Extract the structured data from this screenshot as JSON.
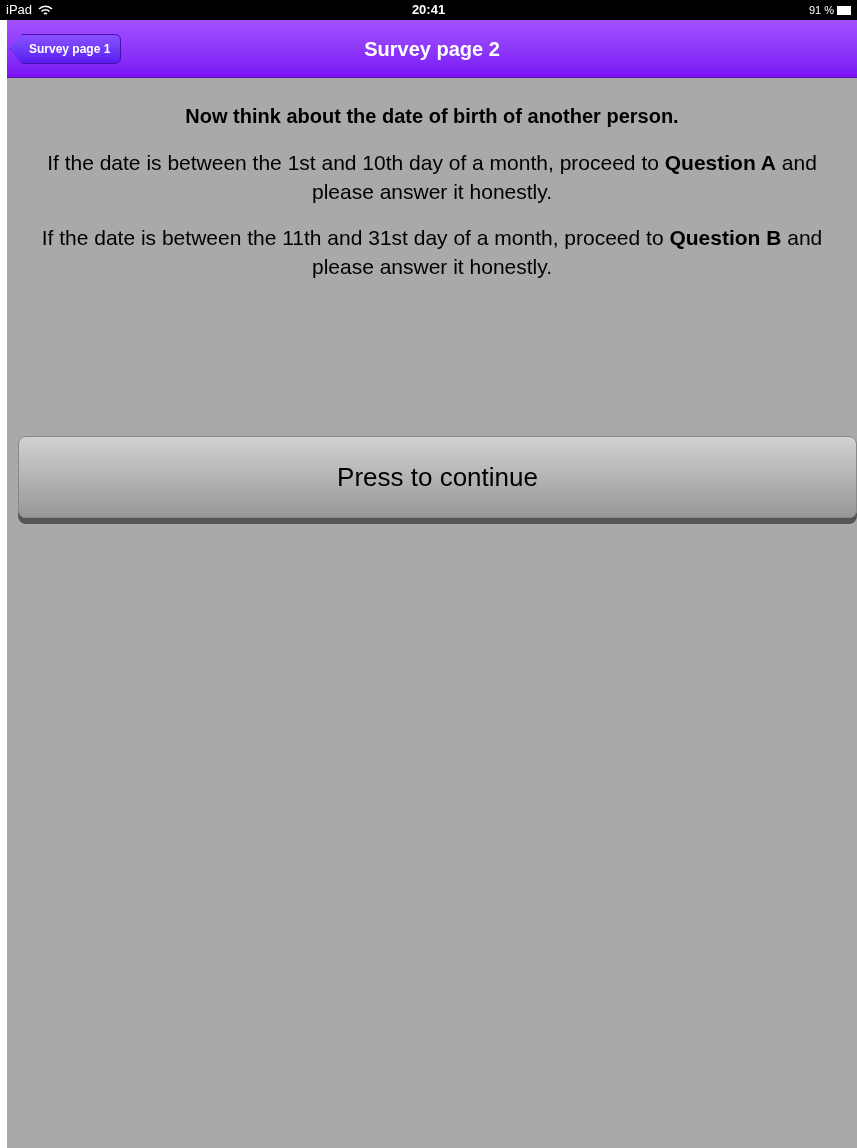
{
  "status_bar": {
    "device": "iPad",
    "time": "20:41",
    "battery": "91 %"
  },
  "nav_bar": {
    "back_button": "Survey page 1",
    "title": "Survey page 2"
  },
  "content": {
    "heading": "Now think about the date of birth of another person.",
    "paragraphs": [
      "If the date is between the 1st and 10th day of a month, proceed to **Question A** and please answer it honestly.",
      "If the date is between the 11th and 31st day of a month, proceed to **Question B** and please answer it honestly."
    ],
    "continue_button": "Press to continue"
  }
}
